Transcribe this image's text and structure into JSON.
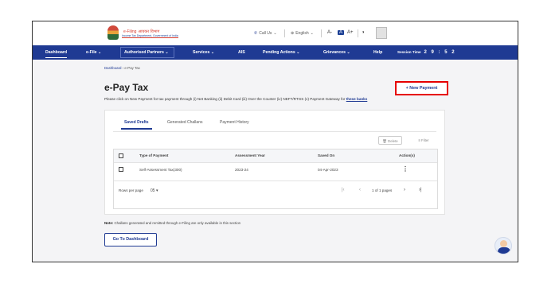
{
  "logo": {
    "title": "e-Filing",
    "title_hindi": "आयकर विभाग",
    "subtitle": "Income Tax Department, Government of India"
  },
  "header": {
    "call_us": "Call Us",
    "language": "English",
    "font_buttons": [
      "A-",
      "A",
      "A+"
    ],
    "contrast_icon": "half-circle-icon"
  },
  "nav": {
    "items": [
      "Dashboard",
      "e-File",
      "Authorised Partners",
      "Services",
      "AIS",
      "Pending Actions",
      "Grievances",
      "Help"
    ],
    "session_label": "Session Time",
    "session_value": "2 9 : 5 2"
  },
  "breadcrumb": {
    "home": "Dashboard",
    "current": "e-Pay Tax"
  },
  "page": {
    "title": "e-Pay Tax",
    "description": "Please click on New Payment for tax payment through (i) Net Banking (ii) Debit Card (iii) Over the Counter (iv) NEFT/RTGS (v) Payment Gateway for",
    "banks_link": "these banks",
    "new_payment": "+ New Payment"
  },
  "tabs": [
    "Saved Drafts",
    "Generated Challans",
    "Payment History"
  ],
  "toolbar": {
    "delete": "Delete",
    "filter": "Filter"
  },
  "table": {
    "columns": [
      "Type of Payment",
      "Assessment Year",
      "Saved On",
      "Action(s)"
    ],
    "rows": [
      {
        "type": "Self-Assessment Tax(300)",
        "year": "2023-24",
        "saved_on": "04-Apr-2023"
      }
    ]
  },
  "pagination": {
    "rows_label": "Rows per page",
    "rows_value": "05",
    "page_info": "1 of 1 pages"
  },
  "note": {
    "label": "Note:",
    "text": "Challans generated and remitted through e-Filing are only available in this section"
  },
  "dashboard_button": "Go To Dashboard",
  "colors": {
    "brand": "#1f3a93",
    "highlight": "#e60000"
  }
}
